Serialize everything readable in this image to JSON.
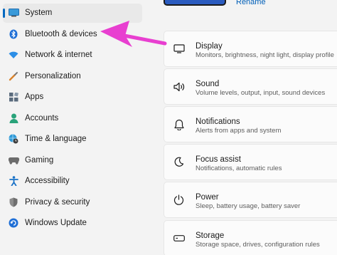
{
  "sidebar": {
    "items": [
      {
        "label": "System",
        "icon": "monitor-icon",
        "selected": true
      },
      {
        "label": "Bluetooth & devices",
        "icon": "bluetooth-icon"
      },
      {
        "label": "Network & internet",
        "icon": "wifi-icon"
      },
      {
        "label": "Personalization",
        "icon": "brush-icon"
      },
      {
        "label": "Apps",
        "icon": "apps-icon"
      },
      {
        "label": "Accounts",
        "icon": "person-icon"
      },
      {
        "label": "Time & language",
        "icon": "globe-clock-icon"
      },
      {
        "label": "Gaming",
        "icon": "gamepad-icon"
      },
      {
        "label": "Accessibility",
        "icon": "accessibility-icon"
      },
      {
        "label": "Privacy & security",
        "icon": "shield-icon"
      },
      {
        "label": "Windows Update",
        "icon": "update-icon"
      }
    ]
  },
  "header": {
    "rename_label": "Rename"
  },
  "cards": [
    {
      "title": "Display",
      "desc": "Monitors, brightness, night light, display profile",
      "icon": "display-icon"
    },
    {
      "title": "Sound",
      "desc": "Volume levels, output, input, sound devices",
      "icon": "speaker-icon"
    },
    {
      "title": "Notifications",
      "desc": "Alerts from apps and system",
      "icon": "bell-icon"
    },
    {
      "title": "Focus assist",
      "desc": "Notifications, automatic rules",
      "icon": "moon-icon"
    },
    {
      "title": "Power",
      "desc": "Sleep, battery usage, battery saver",
      "icon": "power-icon"
    },
    {
      "title": "Storage",
      "desc": "Storage space, drives, configuration rules",
      "icon": "storage-icon"
    }
  ],
  "colors": {
    "accent": "#0067c0",
    "annotation_arrow": "#e83fd0"
  }
}
